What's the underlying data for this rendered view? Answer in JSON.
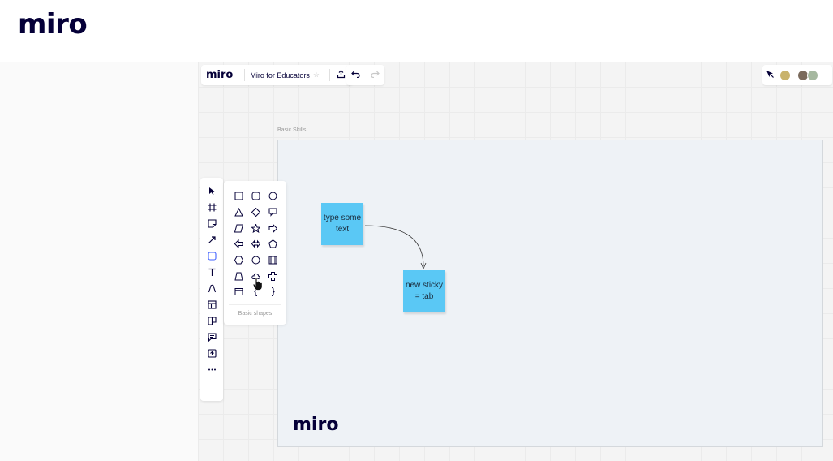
{
  "page": {
    "logo": "miro"
  },
  "board": {
    "logo": "miro",
    "title": "Miro for Educators",
    "star": "☆"
  },
  "frame": {
    "label": "Basic Skills",
    "logo": "miro"
  },
  "stickies": [
    {
      "text": "type some text",
      "color": "#5ac8f5"
    },
    {
      "text": "new sticky = tab",
      "color": "#5ac8f5"
    }
  ],
  "tools": [
    {
      "name": "select-tool",
      "icon": "cursor-arrow-icon"
    },
    {
      "name": "frame-tool",
      "icon": "frame-icon"
    },
    {
      "name": "sticky-note-tool",
      "icon": "sticky-note-icon"
    },
    {
      "name": "connection-line-tool",
      "icon": "arrow-icon"
    },
    {
      "name": "shapes-tool",
      "icon": "rounded-square-icon",
      "active": true
    },
    {
      "name": "text-tool",
      "icon": "text-icon"
    },
    {
      "name": "pen-tool",
      "icon": "pen-icon"
    },
    {
      "name": "templates-tool",
      "icon": "template-icon"
    },
    {
      "name": "cards-tool",
      "icon": "card-icon"
    },
    {
      "name": "comment-tool",
      "icon": "comment-icon"
    },
    {
      "name": "upload-tool",
      "icon": "upload-icon"
    },
    {
      "name": "more-tools",
      "icon": "more-icon"
    }
  ],
  "shapes_panel": {
    "label": "Basic shapes",
    "shapes": [
      "rectangle",
      "rounded-rectangle",
      "circle",
      "triangle",
      "rhombus",
      "speech-bubble",
      "parallelogram",
      "star",
      "right-arrow",
      "left-arrow",
      "double-arrow",
      "pentagon",
      "hexagon",
      "octagon",
      "process",
      "trapezoid",
      "cloud",
      "cross",
      "window",
      "left-brace",
      "right-brace"
    ]
  },
  "colors": {
    "brand": "#050038",
    "accent": "#4262ff",
    "sticky": "#5ac8f5"
  }
}
